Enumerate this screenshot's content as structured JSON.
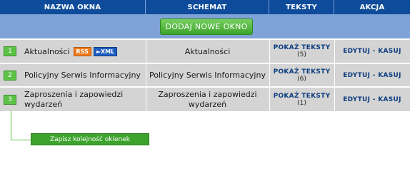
{
  "header": {
    "col_name": "NAZWA OKNA",
    "col_schema": "SCHEMAT",
    "col_texts": "TEKSTY",
    "col_action": "AKCJA"
  },
  "add_button": "DODAJ NOWE OKNO",
  "rows": [
    {
      "index": "1",
      "name": "Aktualności",
      "rss": "RSS",
      "xml": "XML",
      "schema": "Aktualności",
      "show_texts": "POKAŻ TEKSTY",
      "count": "(5)",
      "action": "EDYTUJ - KASUJ"
    },
    {
      "index": "2",
      "name": "Policyjny Serwis Informacyjny",
      "schema": "Policyjny Serwis Informacyjny",
      "show_texts": "POKAŻ TEKSTY",
      "count": "(6)",
      "action": "EDYTUJ - KASUJ"
    },
    {
      "index": "3",
      "name": "Zaproszenia i zapowiedzi wydarzeń",
      "schema": "Zaproszenia i zapowiedzi wydarzeń",
      "show_texts": "POKAŻ TEKSTY",
      "count": "(1)",
      "action": "EDYTUJ - KASUJ"
    }
  ],
  "save_order_button": "Zapisz kolejność okienek"
}
